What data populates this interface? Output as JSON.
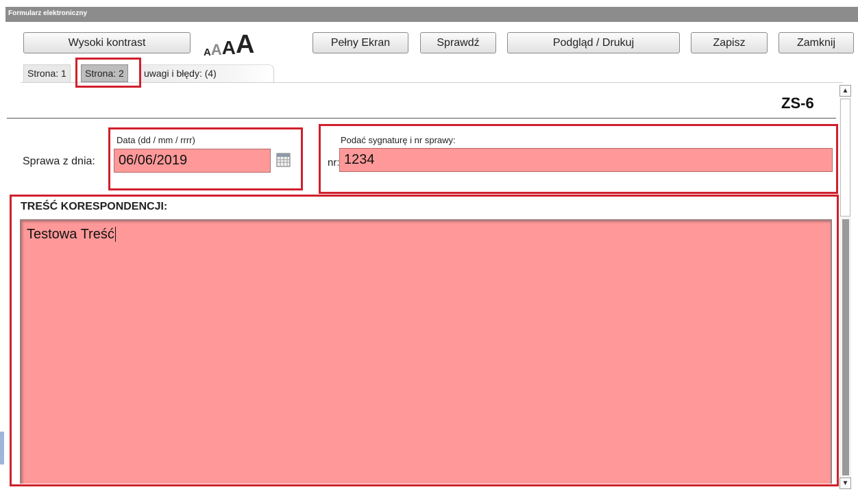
{
  "window": {
    "title": "Formularz elektroniczny"
  },
  "toolbar": {
    "high_contrast": "Wysoki kontrast",
    "font_sizes": [
      "A",
      "A",
      "A",
      "A"
    ],
    "full_screen": "Pełny Ekran",
    "check": "Sprawdź",
    "preview_print": "Podgląd / Drukuj",
    "save": "Zapisz",
    "close": "Zamknij"
  },
  "tabs": [
    {
      "label": "Strona: 1",
      "active": false
    },
    {
      "label": "Strona: 2",
      "active": true
    },
    {
      "label": "uwagi i błędy: (4)",
      "active": false
    }
  ],
  "form": {
    "code": "ZS-6",
    "case_date_label": "Sprawa z dnia:",
    "date_hint": "Data (dd / mm / rrrr)",
    "date_value": "06/06/2019",
    "signature_hint": "Podać sygnaturę i nr sprawy:",
    "nr_label": "nr:",
    "signature_value": "1234",
    "correspondence_label": "TREŚĆ KORESPONDENCJI:",
    "correspondence_value": "Testowa Treść"
  },
  "colors": {
    "error_field": "#ff9999",
    "highlight_box": "#d0202c",
    "titlebar": "#8c8c8c"
  }
}
